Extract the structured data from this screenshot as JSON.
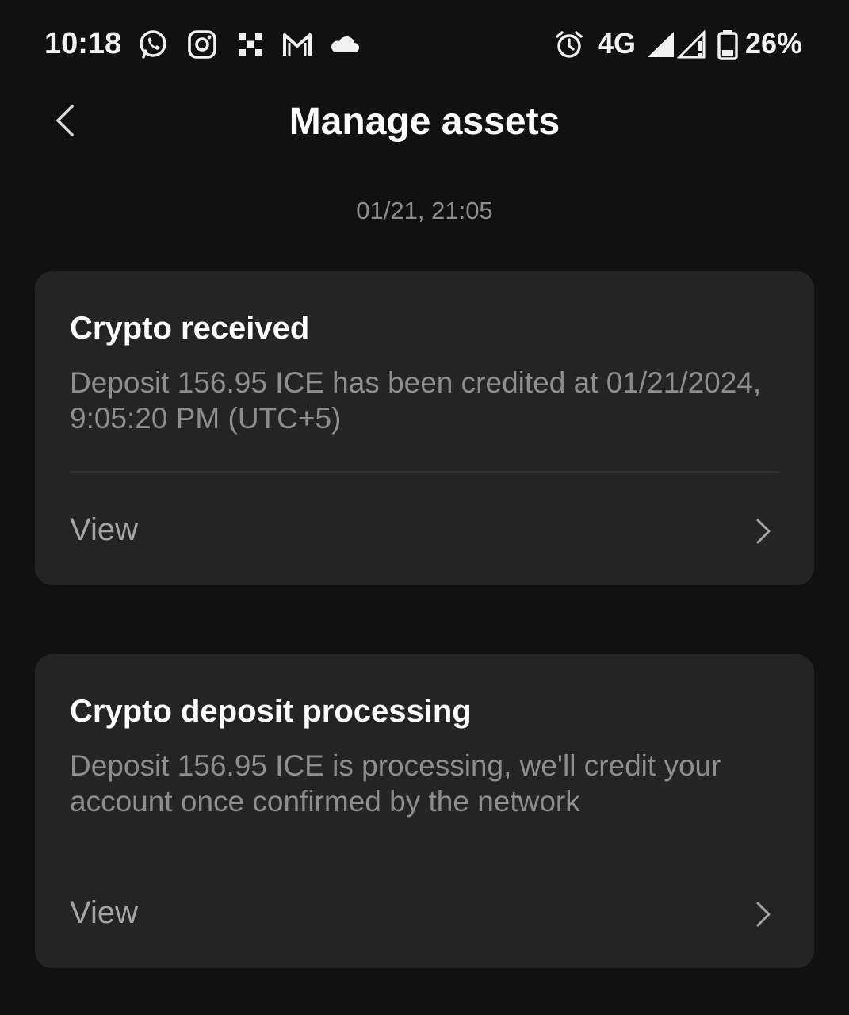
{
  "status_bar": {
    "time": "10:18",
    "icons_left": [
      "whatsapp-icon",
      "instagram-icon",
      "okx-icon",
      "gmail-icon",
      "cloud-icon"
    ],
    "icons_right": [
      "alarm-icon",
      "signal-icon",
      "signal-alert-icon",
      "battery-icon"
    ],
    "network": "4G",
    "battery": "26%"
  },
  "header": {
    "title": "Manage assets",
    "back_icon": "chevron-left-icon"
  },
  "timestamp": "01/21, 21:05",
  "notifications": [
    {
      "title": "Crypto received",
      "body": "Deposit 156.95 ICE has been credited at 01/21/2024, 9:05:20 PM (UTC+5)",
      "action": "View"
    },
    {
      "title": "Crypto deposit processing",
      "body": "Deposit 156.95 ICE is processing, we'll credit your account once confirmed by the network",
      "action": "View"
    }
  ],
  "colors": {
    "background": "#111111",
    "card": "#242424",
    "muted_text": "#8e8e8e"
  }
}
